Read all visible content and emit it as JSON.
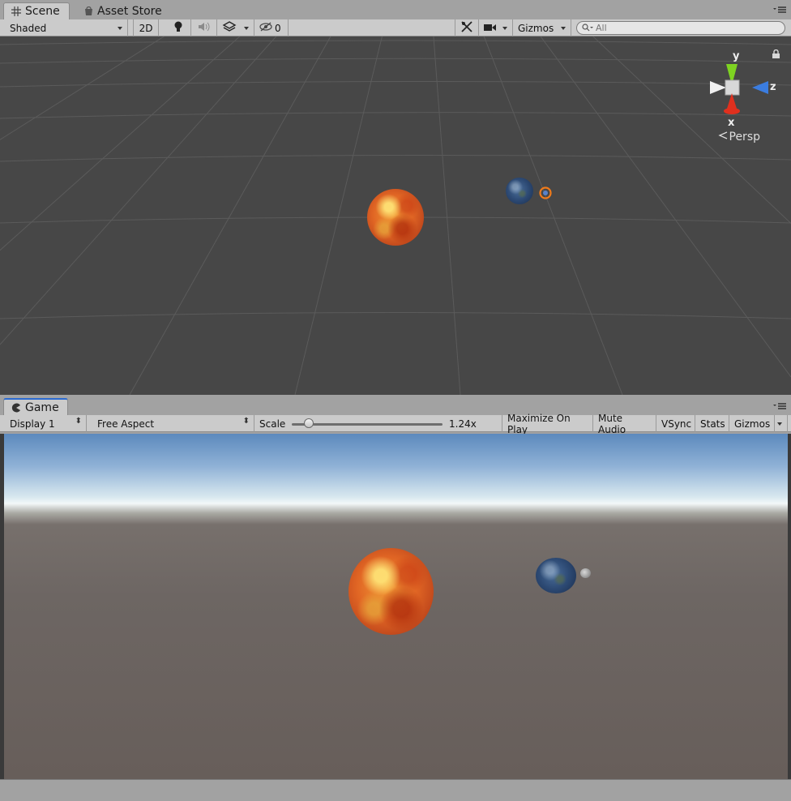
{
  "scene_tabs": {
    "scene": "Scene",
    "asset_store": "Asset Store"
  },
  "scene_toolbar": {
    "shading_mode": "Shaded",
    "mode_2d": "2D",
    "hidden_count": "0",
    "gizmos": "Gizmos",
    "search_placeholder": "All"
  },
  "scene_gizmo": {
    "y": "y",
    "z": "z",
    "x": "x",
    "projection": "Persp"
  },
  "game_tabs": {
    "game": "Game"
  },
  "game_toolbar": {
    "display": "Display 1",
    "aspect": "Free Aspect",
    "scale_label": "Scale",
    "scale_value": "1.24x",
    "scale_fraction": 0.08,
    "maximize_on_play": "Maximize On Play",
    "mute_audio": "Mute Audio",
    "vsync": "VSync",
    "stats": "Stats",
    "gizmos": "Gizmos"
  },
  "colors": {
    "scene_background": "#474747",
    "grid_line": "#5e5e5e",
    "axis_y": "#7ed321",
    "axis_z": "#3b7de0",
    "axis_x": "#e0301e",
    "selection_orange": "#f07a1a",
    "game_tab_accent": "#2c6bd0"
  },
  "icons": {
    "scene_tab": "grid-icon",
    "asset_store_tab": "store-bag-icon",
    "game_tab": "pacman-icon",
    "lighting": "lightbulb-icon",
    "audio": "speaker-icon",
    "effects": "layers-icon",
    "visibility": "eye-slash-icon",
    "tools": "tools-icon",
    "camera": "camera-icon",
    "search": "search-icon",
    "lock": "lock-icon",
    "panel_menu": "panel-menu-icon"
  }
}
